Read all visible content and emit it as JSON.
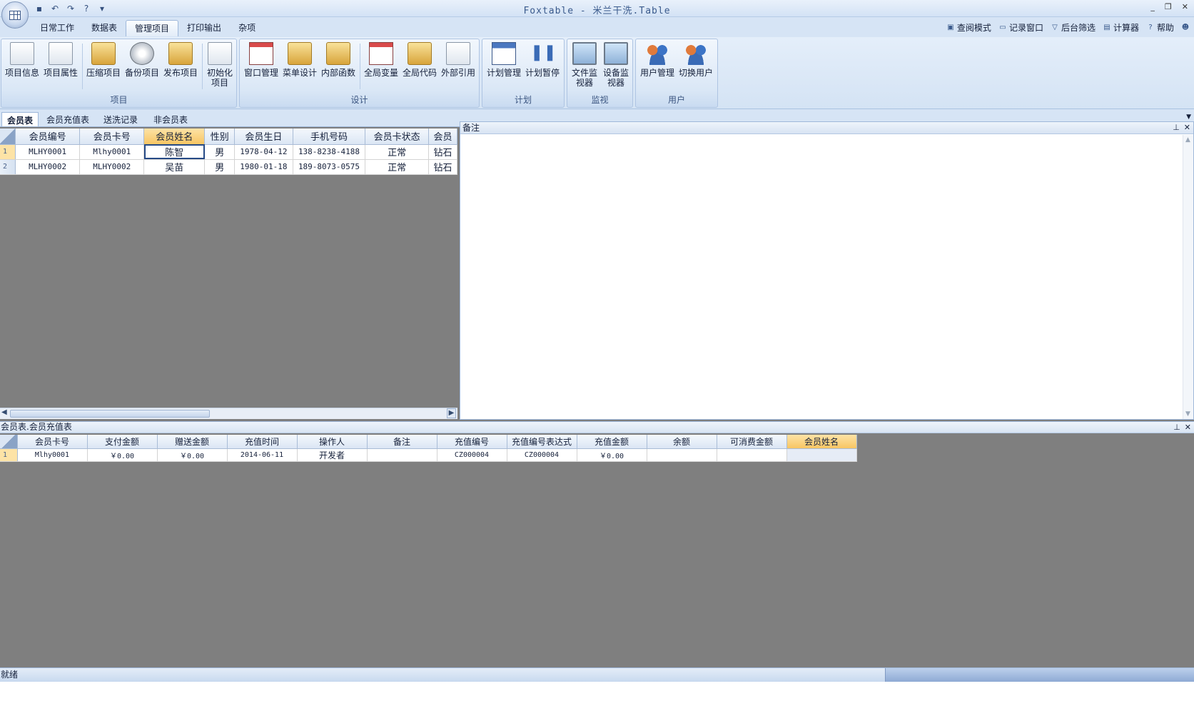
{
  "window": {
    "title": "Foxtable - 米兰干洗.Table",
    "controls": [
      "_",
      "❐",
      "✕"
    ]
  },
  "quick_access": [
    "save-icon",
    "undo-icon",
    "redo-icon",
    "help-icon",
    "customize-icon"
  ],
  "ribbon_tabs": [
    "日常工作",
    "数据表",
    "管理项目",
    "打印输出",
    "杂项"
  ],
  "active_ribbon_tab": "管理项目",
  "right_links": [
    {
      "label": "查阅模式",
      "icon": "lock-icon"
    },
    {
      "label": "记录窗口",
      "icon": "window-icon"
    },
    {
      "label": "后台筛选",
      "icon": "filter-icon"
    },
    {
      "label": "计算器",
      "icon": "calculator-icon"
    },
    {
      "label": "帮助",
      "icon": "help-icon"
    }
  ],
  "groups": [
    {
      "label": "项目",
      "buttons": [
        {
          "label": "项目信息",
          "icon": "certificate-icon"
        },
        {
          "label": "项目属性",
          "icon": "properties-icon"
        },
        {
          "label": "压缩项目",
          "icon": "compress-icon"
        },
        {
          "label": "备份项目",
          "icon": "backup-disk-icon"
        },
        {
          "label": "发布项目",
          "icon": "publish-icon"
        },
        {
          "label": "初始化项目",
          "icon": "initialize-icon"
        }
      ]
    },
    {
      "label": "设计",
      "buttons": [
        {
          "label": "窗口管理",
          "icon": "window-manage-icon"
        },
        {
          "label": "菜单设计",
          "icon": "menu-design-icon"
        },
        {
          "label": "内部函数",
          "icon": "function-icon"
        },
        {
          "label": "全局变量",
          "icon": "global-variable-icon"
        },
        {
          "label": "全局代码",
          "icon": "global-code-icon"
        },
        {
          "label": "外部引用",
          "icon": "reference-icon"
        }
      ]
    },
    {
      "label": "计划",
      "buttons": [
        {
          "label": "计划管理",
          "icon": "calendar-icon"
        },
        {
          "label": "计划暂停",
          "icon": "pause-icon"
        }
      ]
    },
    {
      "label": "监视",
      "buttons": [
        {
          "label": "文件监视器",
          "icon": "file-monitor-icon"
        },
        {
          "label": "设备监视器",
          "icon": "device-monitor-icon"
        }
      ]
    },
    {
      "label": "用户",
      "buttons": [
        {
          "label": "用户管理",
          "icon": "users-icon"
        },
        {
          "label": "切换用户",
          "icon": "switch-user-icon"
        }
      ]
    }
  ],
  "doc_tabs": [
    "会员表",
    "会员充值表",
    "送洗记录",
    "非会员表"
  ],
  "active_doc_tab": "会员表",
  "main_table": {
    "columns": [
      "会员编号",
      "会员卡号",
      "会员姓名",
      "性别",
      "会员生日",
      "手机号码",
      "会员卡状态",
      "会员"
    ],
    "selected_column": "会员姓名",
    "rows": [
      {
        "n": "1",
        "cells": [
          "MLHY0001",
          "Mlhy0001",
          "陈智",
          "男",
          "1978-04-12",
          "138-8238-4188",
          "正常",
          "钻石"
        ]
      },
      {
        "n": "2",
        "cells": [
          "MLHY0002",
          "MLHY0002",
          "吴苗",
          "男",
          "1980-01-18",
          "189-8073-0575",
          "正常",
          "钻石"
        ]
      }
    ]
  },
  "note_panel": {
    "title": "备注"
  },
  "sub_table": {
    "title": "会员表.会员充值表",
    "columns": [
      "会员卡号",
      "支付金额",
      "赠送金额",
      "充值时间",
      "操作人",
      "备注",
      "充值编号",
      "充值编号表达式",
      "充值金额",
      "余额",
      "可消费金额",
      "会员姓名"
    ],
    "selected_column": "会员姓名",
    "rows": [
      {
        "n": "1",
        "cells": [
          "Mlhy0001",
          "￥0.00",
          "￥0.00",
          "2014-06-11",
          "开发者",
          "",
          "CZ000004",
          "CZ000004",
          "￥0.00",
          "",
          "",
          ""
        ]
      }
    ]
  },
  "status": {
    "text": "就绪"
  }
}
